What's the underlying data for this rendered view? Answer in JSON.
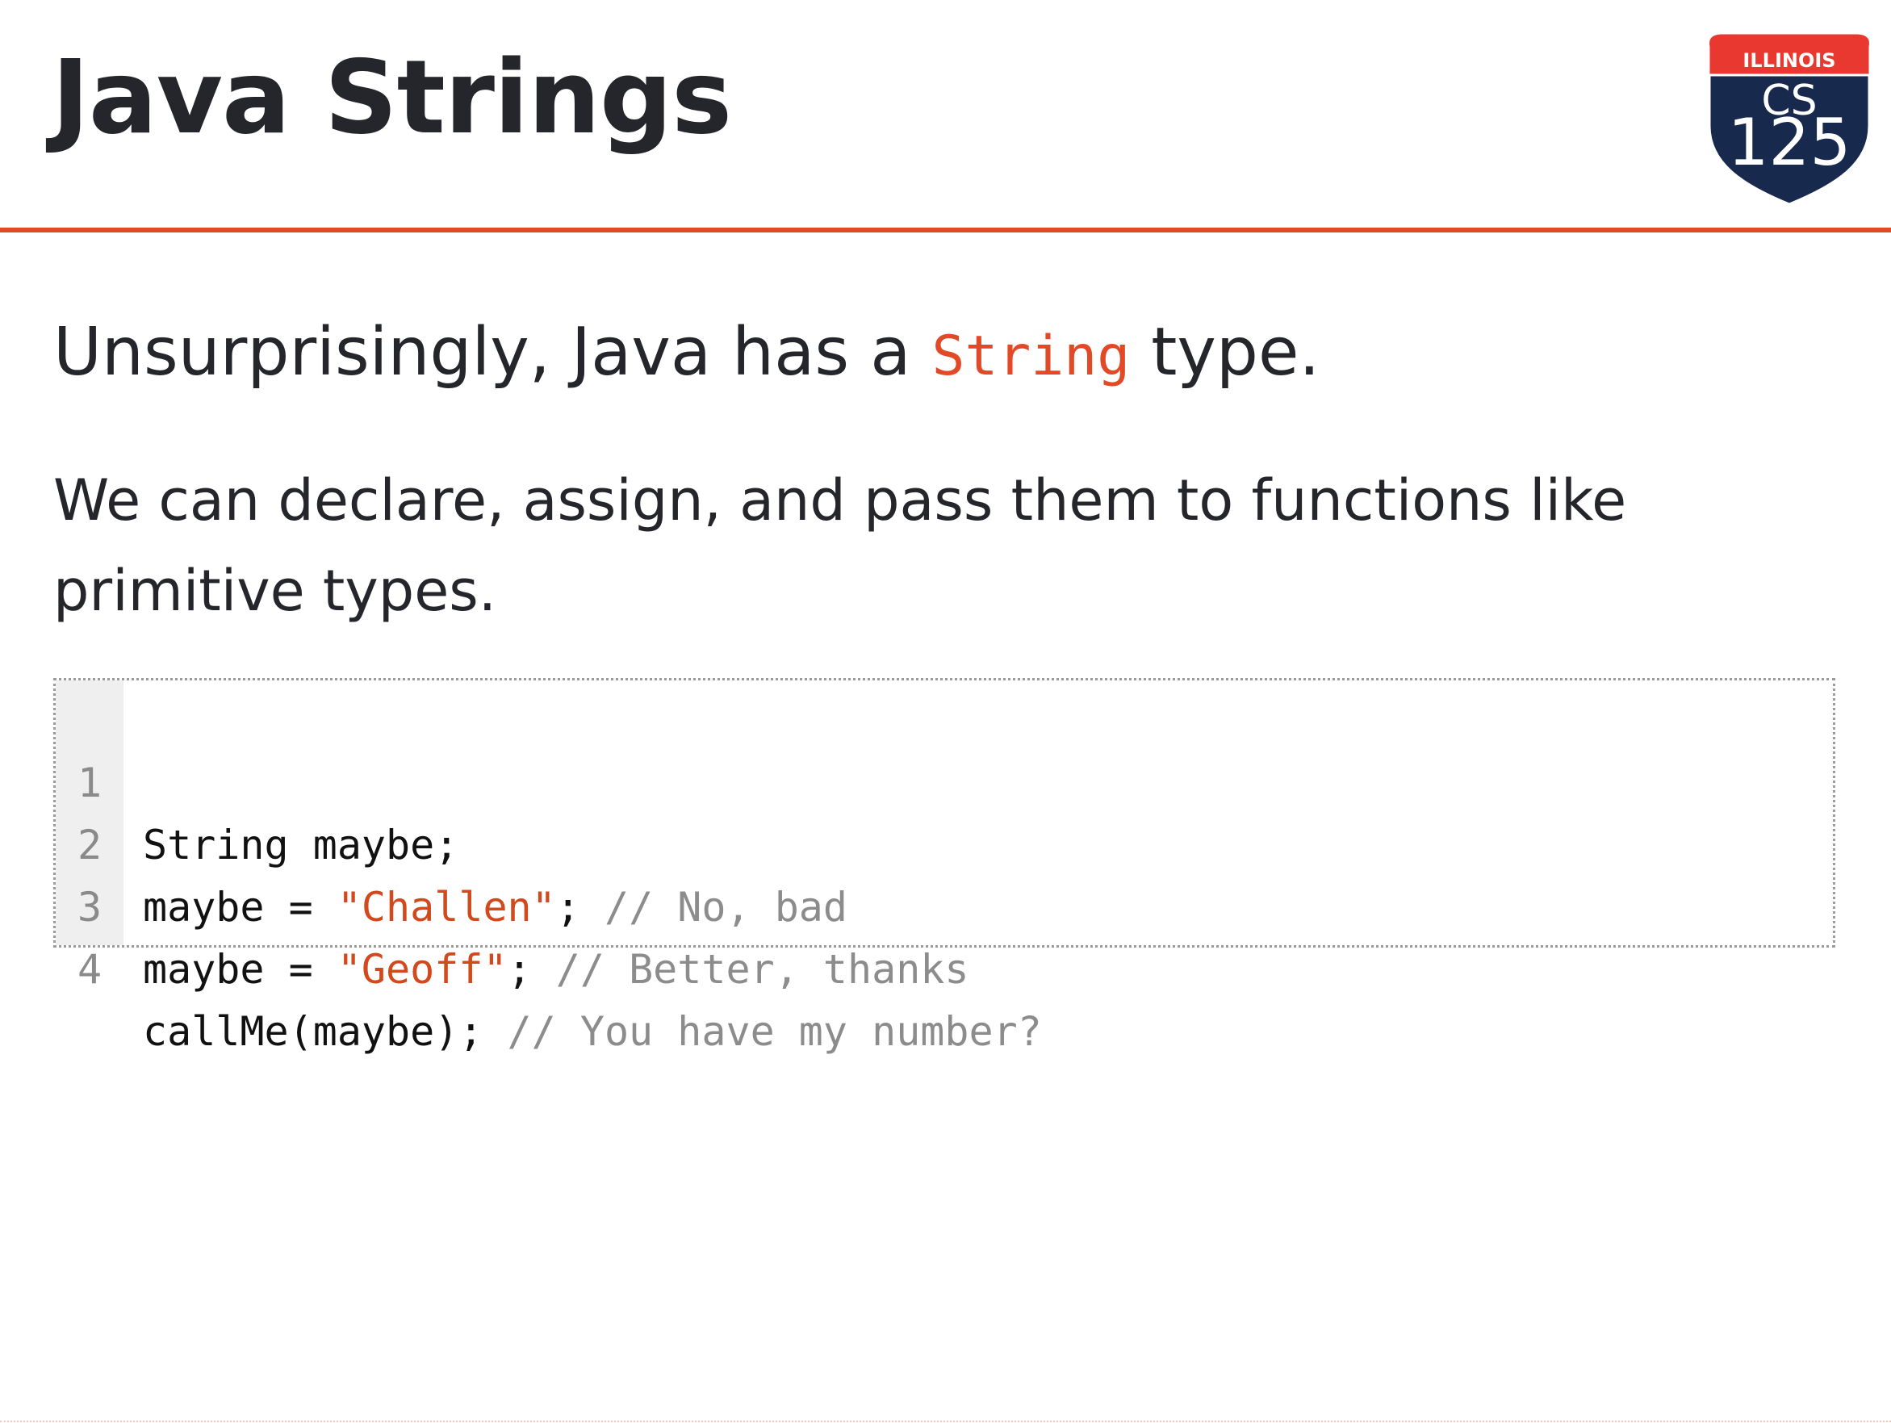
{
  "slide": {
    "title": "Java Strings",
    "lead": {
      "before": "Unsurprisingly, Java has a ",
      "code": "String",
      "after": " type."
    },
    "body": "We can declare, assign, and pass them to functions like primitive types."
  },
  "logo": {
    "icon": "illinois-cs125-shield-icon",
    "top_text": "ILLINOIS",
    "middle_text": "CS",
    "number": "125",
    "colors": {
      "banner": "#e8382f",
      "shield": "#17294d",
      "text": "#ffffff"
    }
  },
  "code_block": {
    "language": "Java",
    "lines": [
      {
        "number": "1",
        "code": "String maybe;",
        "string": "",
        "after_string": "",
        "comment": ""
      },
      {
        "number": "2",
        "code": "maybe = ",
        "string": "\"Challen\"",
        "after_string": "; ",
        "comment": "// No, bad"
      },
      {
        "number": "3",
        "code": "maybe = ",
        "string": "\"Geoff\"",
        "after_string": "; ",
        "comment": "// Better, thanks"
      },
      {
        "number": "4",
        "code": "callMe(maybe); ",
        "string": "",
        "after_string": "",
        "comment": "// You have my number?"
      }
    ]
  },
  "colors": {
    "accent": "#e24a27",
    "heading_text": "#24262b",
    "code_string": "#d1491c",
    "code_comment": "#8c8c8c",
    "gutter_background": "#efefef"
  }
}
